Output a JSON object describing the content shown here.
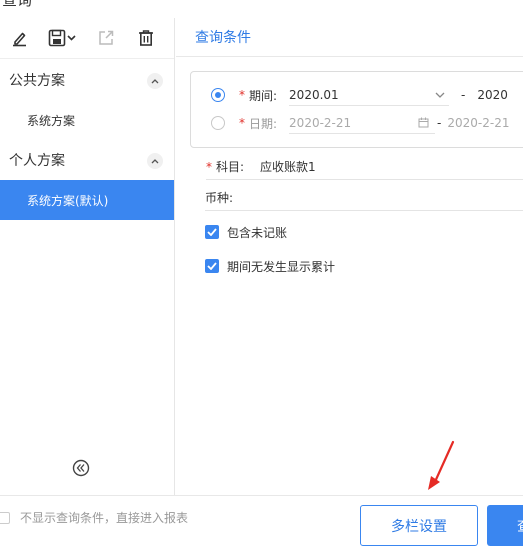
{
  "window": {
    "title": "查询"
  },
  "sidebar": {
    "toolbar": {
      "icons": [
        "edit-icon",
        "save-icon",
        "export-icon",
        "delete-icon"
      ]
    },
    "groups": [
      {
        "title": "公共方案",
        "items": [
          {
            "label": "系统方案",
            "active": false
          }
        ]
      },
      {
        "title": "个人方案",
        "items": [
          {
            "label": "系统方案(默认)",
            "active": true
          }
        ]
      }
    ]
  },
  "main": {
    "header_title": "查询条件",
    "period": {
      "label": "期间:",
      "from": "2020.01",
      "separator": "-",
      "to": "2020"
    },
    "date": {
      "label": "日期:",
      "from": "2020-2-21",
      "separator": "-",
      "to": "2020-2-21"
    },
    "subject": {
      "label": "科目:",
      "value": "应收账款1"
    },
    "currency": {
      "label": "币种:",
      "value": ""
    },
    "options": [
      {
        "label": "包含未记账",
        "checked": true
      },
      {
        "label": "期间无发生显示累计",
        "checked": true
      }
    ]
  },
  "footer": {
    "skip_conditions_label": "不显示查询条件，直接进入报表",
    "multi_column_button": "多栏设置",
    "query_button": "查"
  },
  "colors": {
    "accent": "#3a86f0",
    "required": "#e0302a",
    "annotation_arrow": "#e52b25"
  }
}
